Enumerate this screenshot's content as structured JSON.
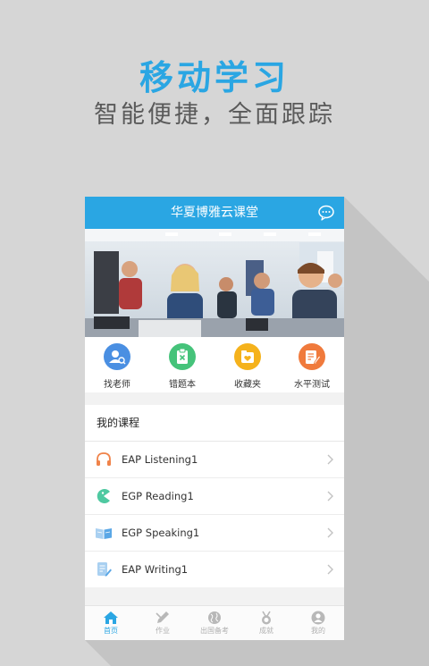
{
  "hero": {
    "title": "移动学习",
    "subtitle": "智能便捷，全面跟踪"
  },
  "app": {
    "title": "华夏博雅云课堂",
    "message_icon": "chat-bubble-icon"
  },
  "shortcuts": [
    {
      "label": "找老师",
      "icon": "teacher-search-icon",
      "color": "#4a8fe2"
    },
    {
      "label": "错题本",
      "icon": "wrong-answers-clipboard-icon",
      "color": "#45c37a"
    },
    {
      "label": "收藏夹",
      "icon": "favorites-folder-icon",
      "color": "#f5b21c"
    },
    {
      "label": "水平测试",
      "icon": "level-test-edit-icon",
      "color": "#f07a3c"
    }
  ],
  "courses": {
    "header": "我的课程",
    "items": [
      {
        "label": "EAP Listening1",
        "icon": "headphones-icon",
        "color": "#f0834a"
      },
      {
        "label": "EGP Reading1",
        "icon": "reading-pacman-icon",
        "color": "#4fc9a1"
      },
      {
        "label": "EGP Speaking1",
        "icon": "open-book-icon",
        "color": "#5aa7e6"
      },
      {
        "label": "EAP Writing1",
        "icon": "writing-document-icon",
        "color": "#5aa7e6"
      }
    ]
  },
  "tabbar": {
    "active_color": "#2aa6e3",
    "inactive_color": "#b0b0b0",
    "tabs": [
      {
        "label": "首页",
        "icon": "home-icon",
        "active": true
      },
      {
        "label": "作业",
        "icon": "homework-pencil-icon",
        "active": false
      },
      {
        "label": "出国备考",
        "icon": "globe-icon",
        "active": false
      },
      {
        "label": "成就",
        "icon": "medal-icon",
        "active": false
      },
      {
        "label": "我的",
        "icon": "user-icon",
        "active": false
      }
    ]
  },
  "colors": {
    "accent": "#2aa6e3",
    "background": "#d6d6d6"
  }
}
